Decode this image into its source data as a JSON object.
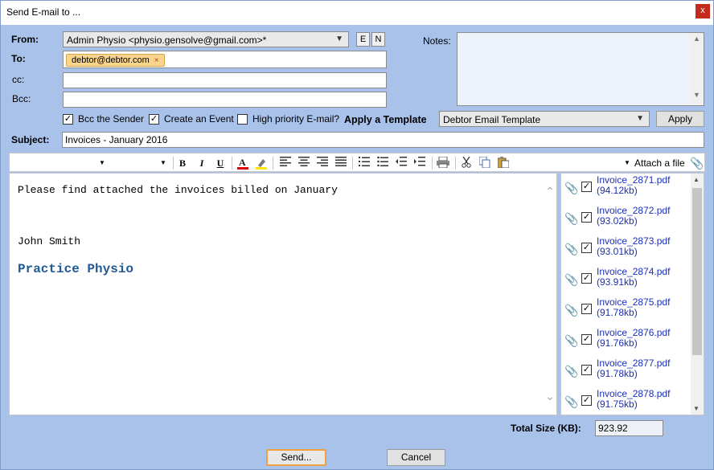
{
  "window": {
    "title": "Send E-mail to ...",
    "close_label": "x"
  },
  "from": {
    "label": "From:",
    "value": "Admin Physio <physio.gensolve@gmail.com>*",
    "btn_e": "E",
    "btn_n": "N"
  },
  "to": {
    "label": "To:",
    "recipients": [
      "debtor@debtor.com"
    ],
    "remove_label": "×"
  },
  "cc": {
    "label": "cc:",
    "value": ""
  },
  "bcc": {
    "label": "Bcc:",
    "value": ""
  },
  "notes": {
    "label": "Notes:",
    "value": ""
  },
  "options": {
    "bcc_sender": {
      "label": "Bcc the Sender",
      "checked": true
    },
    "create_event": {
      "label": "Create an Event",
      "checked": true
    },
    "high_priority": {
      "label": "High priority E-mail?",
      "checked": false
    }
  },
  "template": {
    "label": "Apply a Template",
    "selected": "Debtor Email Template",
    "apply_label": "Apply"
  },
  "subject": {
    "label": "Subject:",
    "value": "Invoices - January 2016"
  },
  "toolbar": {
    "attach_label": "Attach a file",
    "bold": "B",
    "italic": "I",
    "underline": "U"
  },
  "body": {
    "line1": "Please find attached the invoices billed on January",
    "line2": "John Smith",
    "signature": "Practice Physio"
  },
  "attachments": [
    {
      "name": "Invoice_2871.pdf",
      "size": "(94.12kb)",
      "checked": true
    },
    {
      "name": "Invoice_2872.pdf",
      "size": "(93.02kb)",
      "checked": true
    },
    {
      "name": "Invoice_2873.pdf",
      "size": "(93.01kb)",
      "checked": true
    },
    {
      "name": "Invoice_2874.pdf",
      "size": "(93.91kb)",
      "checked": true
    },
    {
      "name": "Invoice_2875.pdf",
      "size": "(91.78kb)",
      "checked": true
    },
    {
      "name": "Invoice_2876.pdf",
      "size": "(91.76kb)",
      "checked": true
    },
    {
      "name": "Invoice_2877.pdf",
      "size": "(91.78kb)",
      "checked": true
    },
    {
      "name": "Invoice_2878.pdf",
      "size": "(91.75kb)",
      "checked": true
    }
  ],
  "total": {
    "label": "Total Size (KB):",
    "value": "923.92"
  },
  "actions": {
    "send_label": "Send...",
    "cancel_label": "Cancel"
  }
}
